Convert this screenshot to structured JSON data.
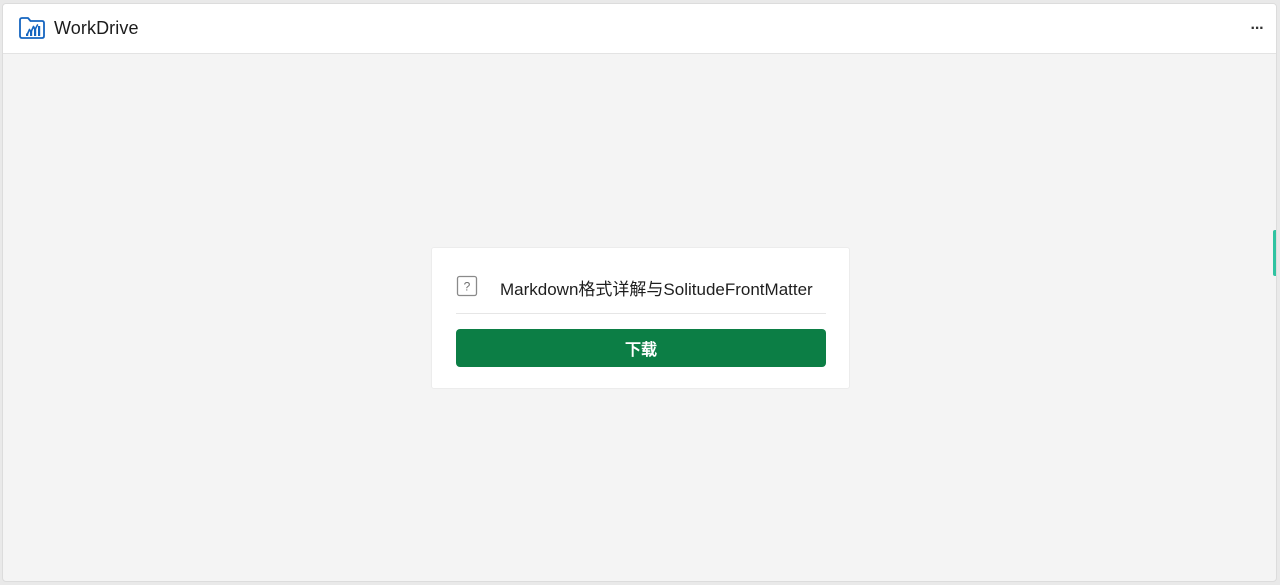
{
  "app": {
    "name": "WorkDrive",
    "logo_icon": "workdrive-folder-icon",
    "brand_color": "#1565c0"
  },
  "header": {
    "more_icon": "more-horizontal-icon",
    "more_label": "···"
  },
  "file": {
    "icon": "unknown-file-icon",
    "icon_glyph": "?",
    "name": "Markdown格式详解与SolitudeFrontMatter"
  },
  "actions": {
    "download_label": "下载",
    "download_color": "#0c7e45"
  }
}
